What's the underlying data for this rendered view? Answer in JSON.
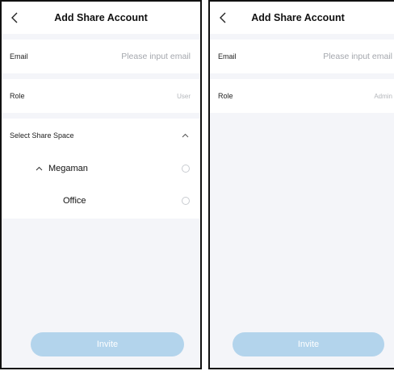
{
  "left": {
    "header": {
      "title": "Add Share Account"
    },
    "email": {
      "label": "Email",
      "placeholder": "Please input email"
    },
    "role": {
      "label": "Role",
      "value": "User"
    },
    "share_space": {
      "label": "Select Share Space",
      "items": [
        {
          "label": "Megaman"
        },
        {
          "label": "Office"
        }
      ]
    },
    "invite_label": "Invite"
  },
  "right": {
    "header": {
      "title": "Add Share Account"
    },
    "email": {
      "label": "Email",
      "placeholder": "Please input email"
    },
    "role": {
      "label": "Role",
      "value": "Admin"
    },
    "invite_label": "Invite"
  },
  "icons": {
    "back": "chevron-left-icon",
    "collapse": "chevron-up-icon",
    "radio": "radio-unchecked-icon"
  },
  "colors": {
    "background": "#f4f5f9",
    "panel": "#ffffff",
    "invite_button": "#b3d4ec",
    "placeholder_text": "#a4a7ad"
  }
}
